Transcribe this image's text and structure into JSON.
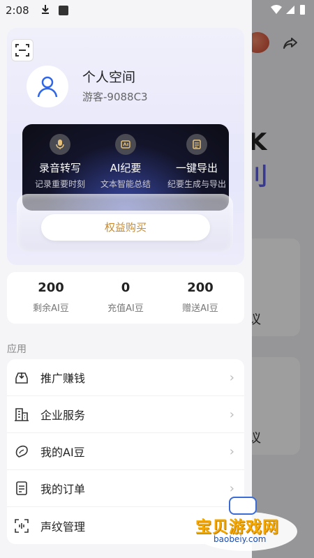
{
  "status_bar": {
    "time": "2:08"
  },
  "profile": {
    "title": "个人空间",
    "guest_id": "游客-9088C3"
  },
  "features": [
    {
      "name": "录音转写",
      "desc": "记录重要时刻",
      "icon": "microphone-icon"
    },
    {
      "name": "AI纪要",
      "desc": "文本智能总结",
      "icon": "ai-summary-icon"
    },
    {
      "name": "一键导出",
      "desc": "纪要生成与导出",
      "icon": "export-document-icon"
    }
  ],
  "buy_button": "权益购买",
  "stats": [
    {
      "value": "200",
      "label": "剩余AI豆"
    },
    {
      "value": "0",
      "label": "充值AI豆"
    },
    {
      "value": "200",
      "label": "赠送AI豆"
    }
  ],
  "section_title": "应用",
  "menu": [
    {
      "label": "推广赚钱",
      "icon": "inbox-download-icon"
    },
    {
      "label": "企业服务",
      "icon": "building-icon"
    },
    {
      "label": "我的AI豆",
      "icon": "bean-icon"
    },
    {
      "label": "我的订单",
      "icon": "order-list-icon"
    },
    {
      "label": "声纹管理",
      "icon": "voiceprint-scan-icon"
    }
  ],
  "background": {
    "big_text_1": "K",
    "big_text_2": "刂",
    "card_text_1": "议",
    "card_text_2": "议"
  },
  "watermark": {
    "title": "宝贝游戏网",
    "url": "baobeiy.com"
  },
  "colors": {
    "accent_gold": "#c98a2c",
    "panel_dark": "#13142a",
    "brand_blue": "#5a5cf0"
  }
}
